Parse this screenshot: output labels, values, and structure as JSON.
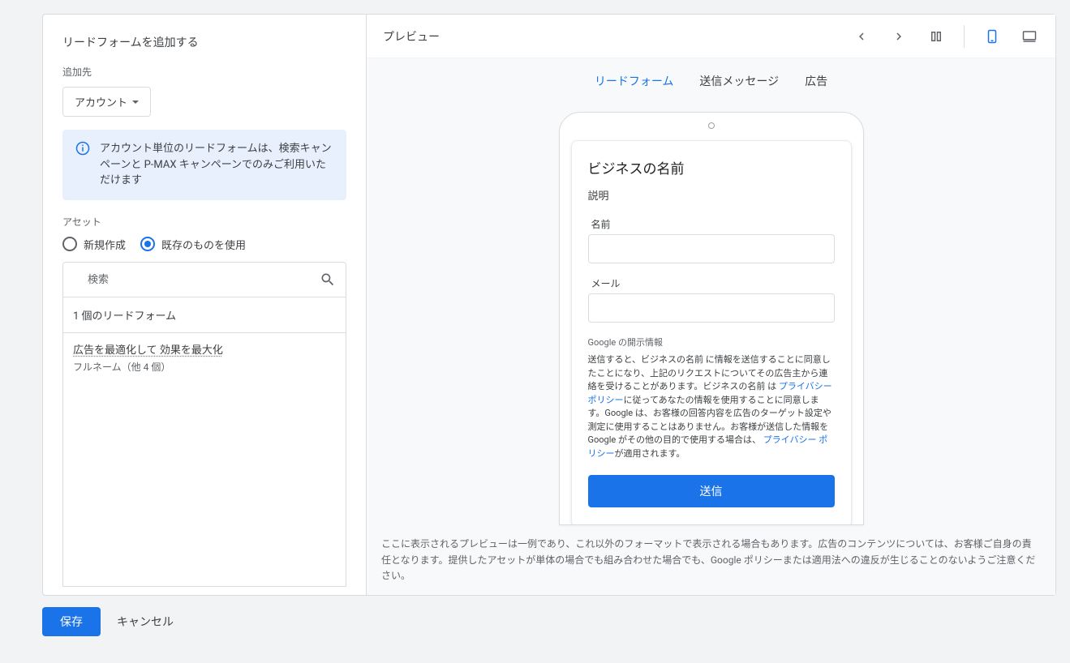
{
  "left": {
    "title": "リードフォームを追加する",
    "dest_label": "追加先",
    "dest_select": "アカウント",
    "info": "アカウント単位のリードフォームは、検索キャンペーンと P-MAX キャンペーンでのみご利用いただけます",
    "asset_label": "アセット",
    "radio_new": "新規作成",
    "radio_existing": "既存のものを使用",
    "search_placeholder": "検索",
    "results_header": "1 個のリードフォーム",
    "result_title": "広告を最適化して 効果を最大化",
    "result_sub": "フルネーム（他 4 個）"
  },
  "right": {
    "preview_title": "プレビュー",
    "tabs": {
      "lead_form": "リードフォーム",
      "submit_msg": "送信メッセージ",
      "ad": "広告"
    },
    "form": {
      "biz_name": "ビジネスの名前",
      "desc": "説明",
      "name_label": "名前",
      "email_label": "メール",
      "disclosure_label": "Google の開示情報",
      "disclosure_1a": "送信すると、ビジネスの名前 に情報を送信することに同意したことになり、上記のリクエストについてその広告主から連絡を受けることがあります。ビジネスの名前 は",
      "privacy_link": "プライバシー ポリシー",
      "disclosure_1b": "に従ってあなたの情報を使用することに同意します。Google は、お客様の回答内容を広告のターゲット設定や測定に使用することはありません。お客様が送信した情報を Google がその他の目的で使用する場合は、",
      "disclosure_1c": "が適用されます。",
      "submit": "送信"
    },
    "footnote": "ここに表示されるプレビューは一例であり、これ以外のフォーマットで表示される場合もあります。広告のコンテンツについては、お客様ご自身の責任となります。提供したアセットが単体の場合でも組み合わせた場合でも、Google ポリシーまたは適用法への違反が生じることのないようご注意ください。"
  },
  "actions": {
    "save": "保存",
    "cancel": "キャンセル"
  }
}
